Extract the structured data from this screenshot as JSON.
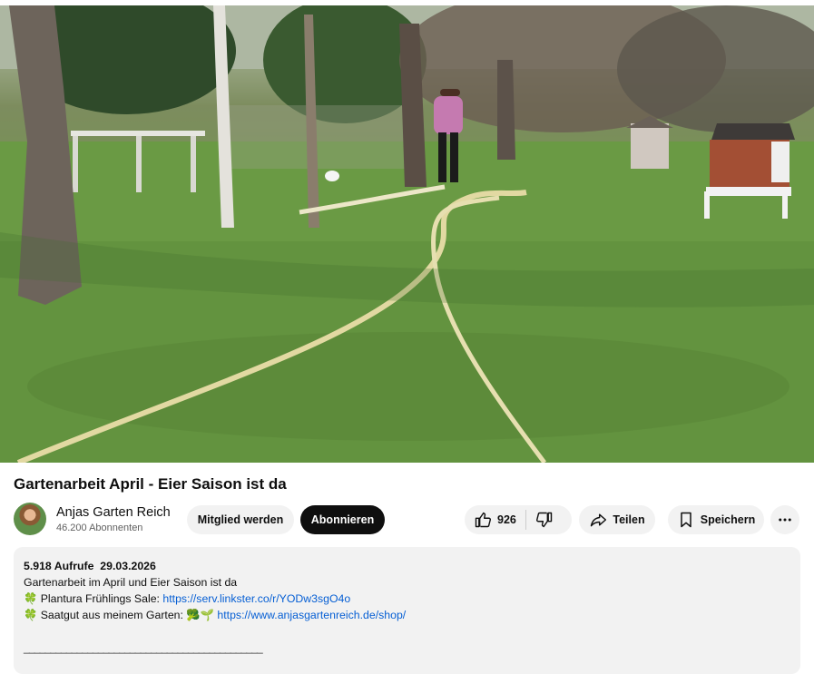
{
  "video": {
    "scene_description_hidden": true
  },
  "title": "Gartenarbeit April - Eier Saison ist da",
  "channel": {
    "name": "Anjas Garten Reich",
    "subscribers": "46.200 Abonnenten"
  },
  "actions": {
    "join_label": "Mitglied werden",
    "subscribe_label": "Abonnieren",
    "like_count": "926",
    "share_label": "Teilen",
    "save_label": "Speichern"
  },
  "description": {
    "views": "5.918 Aufrufe",
    "date": "29.03.2026",
    "line1": "Gartenarbeit im April und Eier Saison ist da",
    "line2_prefix": "🍀 Plantura Frühlings Sale: ",
    "line2_link": "https://serv.linkster.co/r/YODw3sgO4o",
    "line3_prefix": "🍀 Saatgut aus meinem Garten: 🥦🌱 ",
    "line3_link": "https://www.anjasgartenreich.de/shop/",
    "divider": "_____________________________________________"
  },
  "icons": {
    "like": "thumbs-up-icon",
    "dislike": "thumbs-down-icon",
    "share": "share-icon",
    "save": "bookmark-icon",
    "more": "more-horizontal-icon"
  },
  "colors": {
    "subscribe_bg": "#0f0f0f",
    "link": "#065fd4",
    "pill_bg": "#f2f2f2"
  }
}
